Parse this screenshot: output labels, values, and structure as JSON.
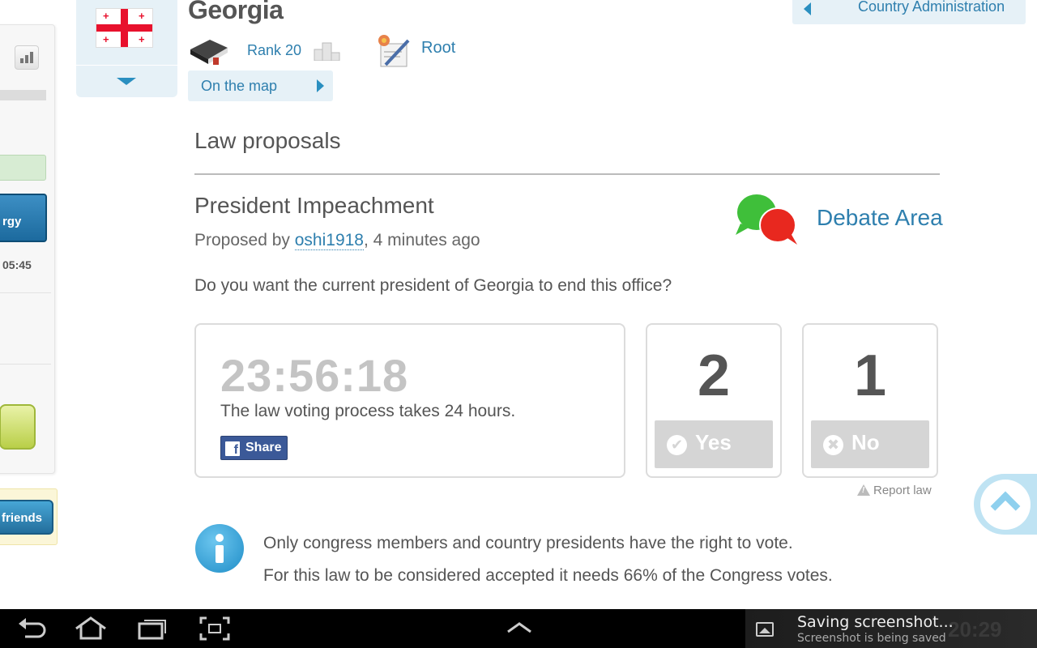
{
  "sidebar": {
    "energy_label": "rgy",
    "time": "05:45",
    "friends_label": "friends"
  },
  "header": {
    "country": "Georgia",
    "rank": "Rank 20",
    "root_link": "Root",
    "on_the_map": "On the map",
    "country_administration": "Country Administration"
  },
  "main": {
    "section_title": "Law proposals",
    "law_title": "President Impeachment",
    "proposed_prefix": "Proposed by ",
    "proposer": "oshi1918",
    "proposed_suffix": ", 4 minutes ago",
    "debate_area": "Debate Area",
    "question": "Do you want the current president of Georgia to end this office?",
    "timer": "23:56:18",
    "timer_note": "The law voting process takes 24 hours.",
    "share_label": "Share",
    "yes_count": "2",
    "yes_label": "Yes",
    "no_count": "1",
    "no_label": "No",
    "report_law": "Report law",
    "info_line1": "Only congress members and country presidents have the right to vote.",
    "info_line2": "For this law to be considered accepted it needs 66% of the Congress votes."
  },
  "status_bar": {
    "notification_title": "Saving screenshot...",
    "notification_text": "Screenshot is being saved",
    "clock": "20:29"
  },
  "colors": {
    "link": "#2e7fae",
    "panel_bg": "#e6f1f7",
    "facebook": "#3b5998",
    "flag_red": "#e8112d",
    "vote_button": "#d5d5d5"
  },
  "icons": [
    "stats-icon",
    "georgia-flag",
    "chevron-down-icon",
    "book-icon",
    "podium-icon",
    "root-icon",
    "chevron-right-icon",
    "chevron-left-icon",
    "debate-icon",
    "facebook-icon",
    "check-icon",
    "cross-icon",
    "warning-icon",
    "info-icon",
    "scroll-top-icon",
    "back-icon",
    "home-icon",
    "recent-apps-icon",
    "screenshot-icon",
    "up-arrow-icon",
    "image-icon"
  ]
}
